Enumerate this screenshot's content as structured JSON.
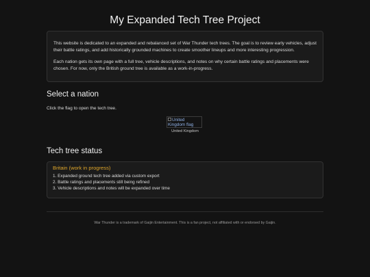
{
  "page": {
    "title": "My Expanded Tech Tree Project"
  },
  "intro": {
    "paragraph1": "This website is dedicated to an expanded and rebalanced set of War Thunder tech trees. The goal is to review early vehicles, adjust their battle ratings, and add historically grounded machines to create smoother lineups and more interesting progression.",
    "paragraph2": "Each nation gets its own page with a full tree, vehicle descriptions, and notes on why certain battle ratings and placements were chosen. For now, only the British ground tree is available as a work-in-progress."
  },
  "select": {
    "heading": "Select a nation",
    "hint": "Click the flag to open the tech tree.",
    "nations": [
      {
        "alt": "United Kingdom flag",
        "caption": "United Kingdom",
        "icon": "uk-flag-icon"
      }
    ]
  },
  "status": {
    "heading": "Tech tree status",
    "card_title": "Britain (work in progress)",
    "items": [
      "1. Expanded ground tech tree added via custom export",
      "2. Battle ratings and placements still being refined",
      "3. Vehicle descriptions and notes will be expanded over time"
    ]
  },
  "footer": {
    "text": "War Thunder is a trademark of Gaijin Entertainment. This is a fan project, not affiliated with or endorsed by Gaijin."
  },
  "colors": {
    "background": "#131313",
    "card": "#1b1b1b",
    "accent": "#e0a72b",
    "link": "#8fb0e6"
  }
}
